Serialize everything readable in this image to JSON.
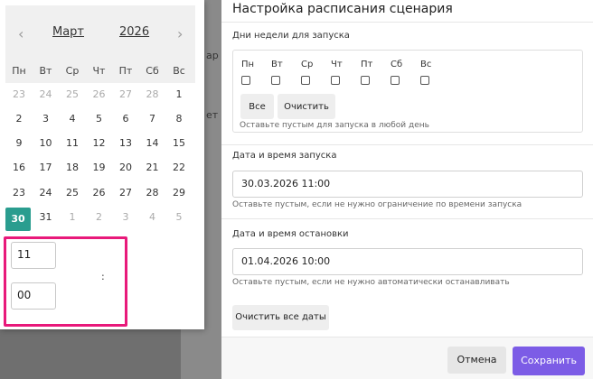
{
  "background": {
    "snippet1": "ар",
    "snippet2": "ет"
  },
  "calendar": {
    "month": "Март",
    "year": "2026",
    "weekdays": [
      "Пн",
      "Вт",
      "Ср",
      "Чт",
      "Пт",
      "Сб",
      "Вс"
    ],
    "weeks": [
      [
        {
          "d": "23",
          "o": true
        },
        {
          "d": "24",
          "o": true
        },
        {
          "d": "25",
          "o": true
        },
        {
          "d": "26",
          "o": true
        },
        {
          "d": "27",
          "o": true
        },
        {
          "d": "28",
          "o": true
        },
        {
          "d": "1",
          "o": false
        }
      ],
      [
        {
          "d": "2",
          "o": false
        },
        {
          "d": "3",
          "o": false
        },
        {
          "d": "4",
          "o": false
        },
        {
          "d": "5",
          "o": false
        },
        {
          "d": "6",
          "o": false
        },
        {
          "d": "7",
          "o": false
        },
        {
          "d": "8",
          "o": false
        }
      ],
      [
        {
          "d": "9",
          "o": false
        },
        {
          "d": "10",
          "o": false
        },
        {
          "d": "11",
          "o": false
        },
        {
          "d": "12",
          "o": false
        },
        {
          "d": "13",
          "o": false
        },
        {
          "d": "14",
          "o": false
        },
        {
          "d": "15",
          "o": false
        }
      ],
      [
        {
          "d": "16",
          "o": false
        },
        {
          "d": "17",
          "o": false
        },
        {
          "d": "18",
          "o": false
        },
        {
          "d": "19",
          "o": false
        },
        {
          "d": "20",
          "o": false
        },
        {
          "d": "21",
          "o": false
        },
        {
          "d": "22",
          "o": false
        }
      ],
      [
        {
          "d": "23",
          "o": false
        },
        {
          "d": "24",
          "o": false
        },
        {
          "d": "25",
          "o": false
        },
        {
          "d": "26",
          "o": false
        },
        {
          "d": "27",
          "o": false
        },
        {
          "d": "28",
          "o": false
        },
        {
          "d": "29",
          "o": false
        }
      ],
      [
        {
          "d": "30",
          "o": false,
          "s": true
        },
        {
          "d": "31",
          "o": false
        },
        {
          "d": "1",
          "o": true
        },
        {
          "d": "2",
          "o": true
        },
        {
          "d": "3",
          "o": true
        },
        {
          "d": "4",
          "o": true
        },
        {
          "d": "5",
          "o": true
        }
      ]
    ],
    "hour": "11",
    "minute": "00",
    "separator": ":",
    "selected_color": "#2a9d8f",
    "highlight_color": "#e8197a"
  },
  "dialog": {
    "title": "Настройка расписания сценария",
    "days_label": "Дни недели для запуска",
    "days": [
      "Пн",
      "Вт",
      "Ср",
      "Чт",
      "Пт",
      "Сб",
      "Вс"
    ],
    "all_button": "Все",
    "clear_button": "Очистить",
    "days_hint": "Оставьте пустым для запуска в любой день",
    "start_label": "Дата и время запуска",
    "start_value": "30.03.2026 11:00",
    "start_hint": "Оставьте пустым, если не нужно ограничение по времени запуска",
    "stop_label": "Дата и время остановки",
    "stop_value": "01.04.2026 10:00",
    "stop_hint": "Оставьте пустым, если не нужно автоматически останавливать",
    "clear_dates_button": "Очистить все даты",
    "cancel_button": "Отмена",
    "save_button": "Сохранить",
    "save_color": "#7c5ce6"
  }
}
